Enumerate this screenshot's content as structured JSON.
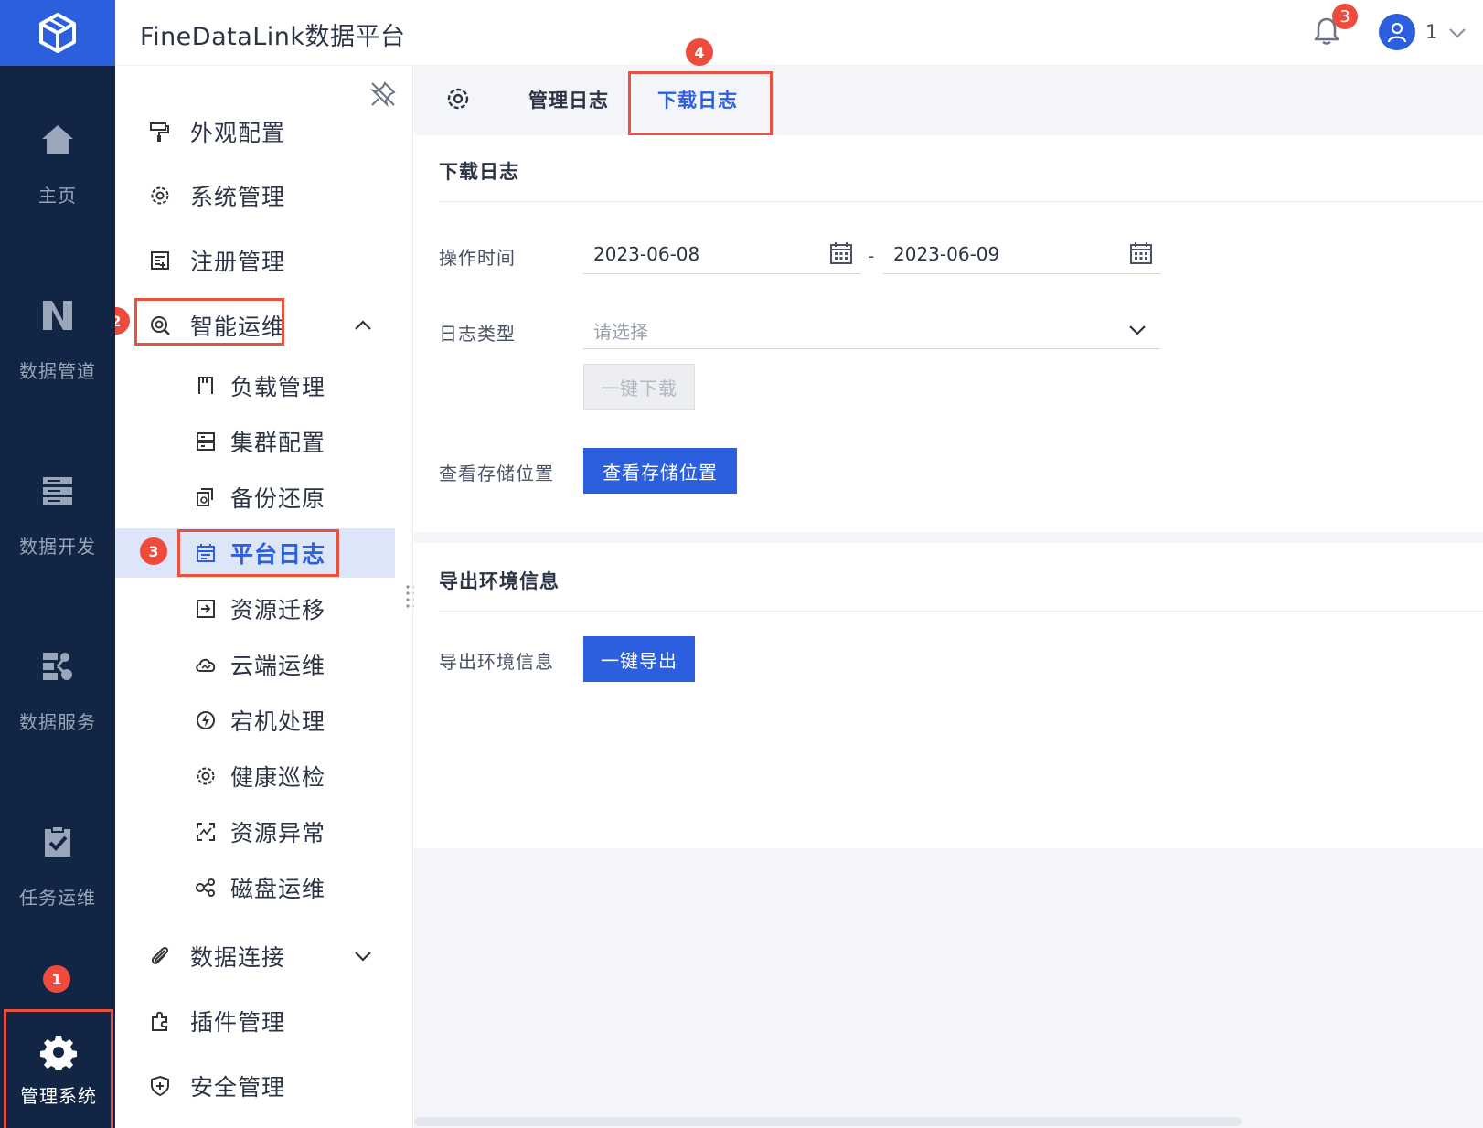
{
  "app": {
    "title": "FineDataLink数据平台"
  },
  "header": {
    "notification_count": "3",
    "user_name": "1"
  },
  "rail": {
    "items": [
      {
        "label": "主页",
        "icon": "home-icon"
      },
      {
        "label": "数据管道",
        "icon": "pipeline-icon"
      },
      {
        "label": "数据开发",
        "icon": "dev-icon"
      },
      {
        "label": "数据服务",
        "icon": "service-icon"
      },
      {
        "label": "任务运维",
        "icon": "task-ops-icon"
      }
    ],
    "active": {
      "label": "管理系统",
      "icon": "gear-icon"
    }
  },
  "menu": {
    "items": [
      {
        "label": "外观配置",
        "icon": "paint-roller-icon"
      },
      {
        "label": "系统管理",
        "icon": "gear-icon"
      },
      {
        "label": "注册管理",
        "icon": "register-icon"
      },
      {
        "label": "智能运维",
        "icon": "smart-ops-icon"
      }
    ],
    "sub_items": [
      {
        "label": "负载管理",
        "icon": "load-icon"
      },
      {
        "label": "集群配置",
        "icon": "cluster-icon"
      },
      {
        "label": "备份还原",
        "icon": "backup-icon"
      },
      {
        "label": "平台日志",
        "icon": "log-icon"
      },
      {
        "label": "资源迁移",
        "icon": "migrate-icon"
      },
      {
        "label": "云端运维",
        "icon": "cloud-icon"
      },
      {
        "label": "宕机处理",
        "icon": "bolt-icon"
      },
      {
        "label": "健康巡检",
        "icon": "health-icon"
      },
      {
        "label": "资源异常",
        "icon": "anomaly-icon"
      },
      {
        "label": "磁盘运维",
        "icon": "disk-icon"
      }
    ],
    "bottom_items": [
      {
        "label": "数据连接",
        "icon": "paperclip-icon"
      },
      {
        "label": "插件管理",
        "icon": "plugin-icon"
      },
      {
        "label": "安全管理",
        "icon": "shield-icon"
      }
    ]
  },
  "steps": {
    "step1": "1",
    "step2": "2",
    "step3": "3",
    "step4": "4"
  },
  "tabs": [
    {
      "label": "管理日志"
    },
    {
      "label": "下载日志"
    }
  ],
  "download_card": {
    "title": "下载日志",
    "time_label": "操作时间",
    "start_date": "2023-06-08",
    "separator": "-",
    "end_date": "2023-06-09",
    "type_label": "日志类型",
    "type_placeholder": "请选择",
    "download_button": "一键下载",
    "storage_label": "查看存储位置",
    "storage_button": "查看存储位置"
  },
  "export_card": {
    "title": "导出环境信息",
    "label": "导出环境信息",
    "button": "一键导出"
  },
  "colors": {
    "brand": "#2c5fde",
    "rail_bg": "#132544",
    "highlight": "#e8533f",
    "badge": "#ef4b3c"
  }
}
